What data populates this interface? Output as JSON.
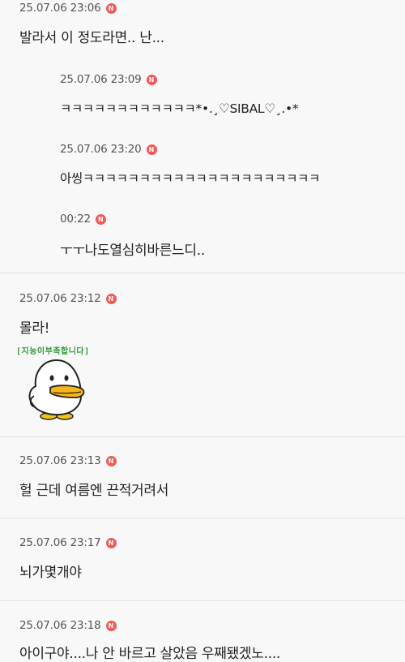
{
  "badge_label": "N",
  "comments": [
    {
      "time": "25.07.06 23:06",
      "text": "발라서 이 정도라면.. 난..."
    },
    {
      "time": "25.07.06 23:09",
      "text": "ㅋㅋㅋㅋㅋㅋㅋㅋㅋㅋㅋㅋ*•.¸♡SIBAL♡¸.•*"
    },
    {
      "time": "25.07.06 23:20",
      "text": "아씽ㅋㅋㅋㅋㅋㅋㅋㅋㅋㅋㅋㅋㅋㅋㅋㅋㅋㅋㅋㅋㅋ"
    },
    {
      "time": "00:22",
      "text": "ㅜㅜ나도열심히바른느디.."
    },
    {
      "time": "25.07.06 23:12",
      "text": "몰라!",
      "sticker_caption": "[지능이부족합니다]"
    },
    {
      "time": "25.07.06 23:13",
      "text": "헐 근데 여름엔 끈적거려서"
    },
    {
      "time": "25.07.06 23:17",
      "text": "뇌가몇개야"
    },
    {
      "time": "25.07.06 23:18",
      "text": "아이구야....나 안 바르고 살았음 우째됐겠노...."
    }
  ]
}
